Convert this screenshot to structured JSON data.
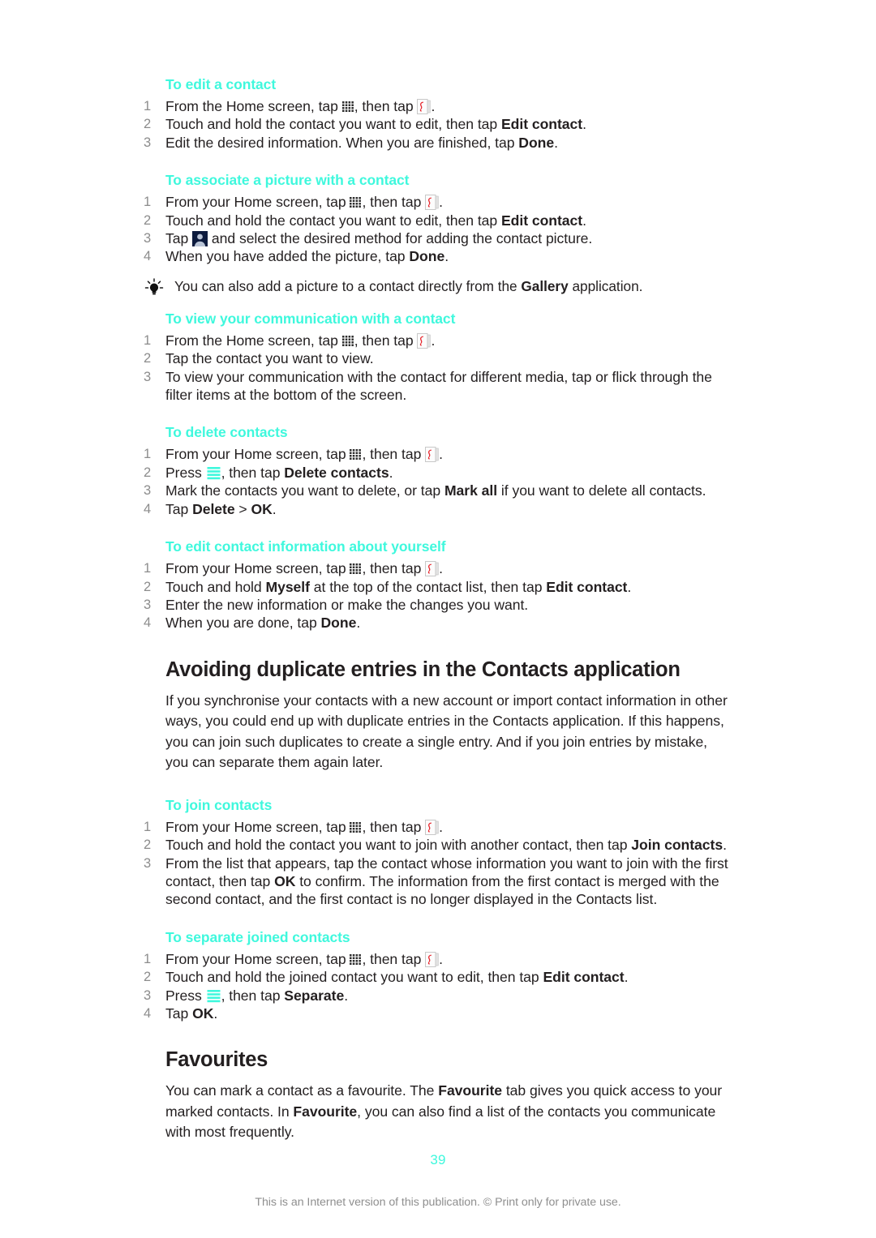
{
  "page": {
    "number": "39",
    "footer_note": "This is an Internet version of this publication. © Print only for private use."
  },
  "icons": {
    "app_grid": "app-grid-icon",
    "contacts": "contacts-book-icon",
    "avatar": "contact-avatar-icon",
    "menu": "menu-icon",
    "tip": "tip-bulb-icon"
  },
  "colors": {
    "heading_accent": "#3ff8dd",
    "body_text": "#231f20",
    "step_number": "#8c8c8c",
    "footer_text": "#8f8f8f"
  },
  "sections": {
    "edit_contact": {
      "heading": "To edit a contact",
      "steps": [
        {
          "num": "1",
          "parts": [
            {
              "t": "From the Home screen, tap "
            },
            {
              "icon": "app_grid"
            },
            {
              "t": ", then tap "
            },
            {
              "icon": "contacts"
            },
            {
              "t": "."
            }
          ]
        },
        {
          "num": "2",
          "parts": [
            {
              "t": "Touch and hold the contact you want to edit, then tap "
            },
            {
              "b": "Edit contact"
            },
            {
              "t": "."
            }
          ]
        },
        {
          "num": "3",
          "parts": [
            {
              "t": "Edit the desired information. When you are finished, tap "
            },
            {
              "b": "Done"
            },
            {
              "t": "."
            }
          ]
        }
      ]
    },
    "associate_picture": {
      "heading": "To associate a picture with a contact",
      "steps": [
        {
          "num": "1",
          "parts": [
            {
              "t": "From your Home screen, tap "
            },
            {
              "icon": "app_grid"
            },
            {
              "t": ", then tap "
            },
            {
              "icon": "contacts"
            },
            {
              "t": "."
            }
          ]
        },
        {
          "num": "2",
          "parts": [
            {
              "t": "Touch and hold the contact you want to edit, then tap "
            },
            {
              "b": "Edit contact"
            },
            {
              "t": "."
            }
          ]
        },
        {
          "num": "3",
          "parts": [
            {
              "t": "Tap "
            },
            {
              "icon": "avatar"
            },
            {
              "t": " and select the desired method for adding the contact picture."
            }
          ]
        },
        {
          "num": "4",
          "parts": [
            {
              "t": "When you have added the picture, tap "
            },
            {
              "b": "Done"
            },
            {
              "t": "."
            }
          ]
        }
      ],
      "tip": [
        {
          "t": "You can also add a picture to a contact directly from the "
        },
        {
          "b": "Gallery"
        },
        {
          "t": " application."
        }
      ]
    },
    "view_communication": {
      "heading": "To view your communication with a contact",
      "steps": [
        {
          "num": "1",
          "parts": [
            {
              "t": "From the Home screen, tap "
            },
            {
              "icon": "app_grid"
            },
            {
              "t": ", then tap "
            },
            {
              "icon": "contacts"
            },
            {
              "t": "."
            }
          ]
        },
        {
          "num": "2",
          "parts": [
            {
              "t": "Tap the contact you want to view."
            }
          ]
        },
        {
          "num": "3",
          "parts": [
            {
              "t": "To view your communication with the contact for different media, tap or flick through the filter items at the bottom of the screen."
            }
          ]
        }
      ]
    },
    "delete_contacts": {
      "heading": "To delete contacts",
      "steps": [
        {
          "num": "1",
          "parts": [
            {
              "t": "From your Home screen, tap "
            },
            {
              "icon": "app_grid"
            },
            {
              "t": ", then tap "
            },
            {
              "icon": "contacts"
            },
            {
              "t": "."
            }
          ]
        },
        {
          "num": "2",
          "parts": [
            {
              "t": "Press "
            },
            {
              "icon": "menu"
            },
            {
              "t": ", then tap "
            },
            {
              "b": "Delete contacts"
            },
            {
              "t": "."
            }
          ]
        },
        {
          "num": "3",
          "parts": [
            {
              "t": "Mark the contacts you want to delete, or tap "
            },
            {
              "b": "Mark all"
            },
            {
              "t": " if you want to delete all contacts."
            }
          ]
        },
        {
          "num": "4",
          "parts": [
            {
              "t": "Tap "
            },
            {
              "b": "Delete"
            },
            {
              "t": " > "
            },
            {
              "b": "OK"
            },
            {
              "t": "."
            }
          ]
        }
      ]
    },
    "edit_own_info": {
      "heading": "To edit contact information about yourself",
      "steps": [
        {
          "num": "1",
          "parts": [
            {
              "t": "From your Home screen, tap "
            },
            {
              "icon": "app_grid"
            },
            {
              "t": ", then tap "
            },
            {
              "icon": "contacts"
            },
            {
              "t": "."
            }
          ]
        },
        {
          "num": "2",
          "parts": [
            {
              "t": "Touch and hold "
            },
            {
              "b": "Myself"
            },
            {
              "t": " at the top of the contact list, then tap "
            },
            {
              "b": "Edit contact"
            },
            {
              "t": "."
            }
          ]
        },
        {
          "num": "3",
          "parts": [
            {
              "t": "Enter the new information or make the changes you want."
            }
          ]
        },
        {
          "num": "4",
          "parts": [
            {
              "t": "When you are done, tap "
            },
            {
              "b": "Done"
            },
            {
              "t": "."
            }
          ]
        }
      ]
    },
    "avoiding_duplicates": {
      "heading": "Avoiding duplicate entries in the Contacts application",
      "body": "If you synchronise your contacts with a new account or import contact information in other ways, you could end up with duplicate entries in the Contacts application. If this happens, you can join such duplicates to create a single entry. And if you join entries by mistake, you can separate them again later."
    },
    "join_contacts": {
      "heading": "To join contacts",
      "steps": [
        {
          "num": "1",
          "parts": [
            {
              "t": "From your Home screen, tap "
            },
            {
              "icon": "app_grid"
            },
            {
              "t": ", then tap "
            },
            {
              "icon": "contacts"
            },
            {
              "t": "."
            }
          ]
        },
        {
          "num": "2",
          "parts": [
            {
              "t": "Touch and hold the contact you want to join with another contact, then tap "
            },
            {
              "b": "Join contacts"
            },
            {
              "t": "."
            }
          ]
        },
        {
          "num": "3",
          "parts": [
            {
              "t": "From the list that appears, tap the contact whose information you want to join with the first contact, then tap "
            },
            {
              "b": "OK"
            },
            {
              "t": " to confirm. The information from the first contact is merged with the second contact, and the first contact is no longer displayed in the Contacts list."
            }
          ]
        }
      ]
    },
    "separate_contacts": {
      "heading": "To separate joined contacts",
      "steps": [
        {
          "num": "1",
          "parts": [
            {
              "t": "From your Home screen, tap "
            },
            {
              "icon": "app_grid"
            },
            {
              "t": ", then tap "
            },
            {
              "icon": "contacts"
            },
            {
              "t": "."
            }
          ]
        },
        {
          "num": "2",
          "parts": [
            {
              "t": "Touch and hold the joined contact you want to edit, then tap "
            },
            {
              "b": "Edit contact"
            },
            {
              "t": "."
            }
          ]
        },
        {
          "num": "3",
          "parts": [
            {
              "t": "Press "
            },
            {
              "icon": "menu"
            },
            {
              "t": ", then tap "
            },
            {
              "b": "Separate"
            },
            {
              "t": "."
            }
          ]
        },
        {
          "num": "4",
          "parts": [
            {
              "t": "Tap "
            },
            {
              "b": "OK"
            },
            {
              "t": "."
            }
          ]
        }
      ]
    },
    "favourites": {
      "heading": "Favourites",
      "body_parts": [
        {
          "t": "You can mark a contact as a favourite. The "
        },
        {
          "b": "Favourite"
        },
        {
          "t": " tab gives you quick access to your marked contacts. In "
        },
        {
          "b": "Favourite"
        },
        {
          "t": ", you can also find a list of the contacts you communicate with most frequently."
        }
      ]
    }
  }
}
